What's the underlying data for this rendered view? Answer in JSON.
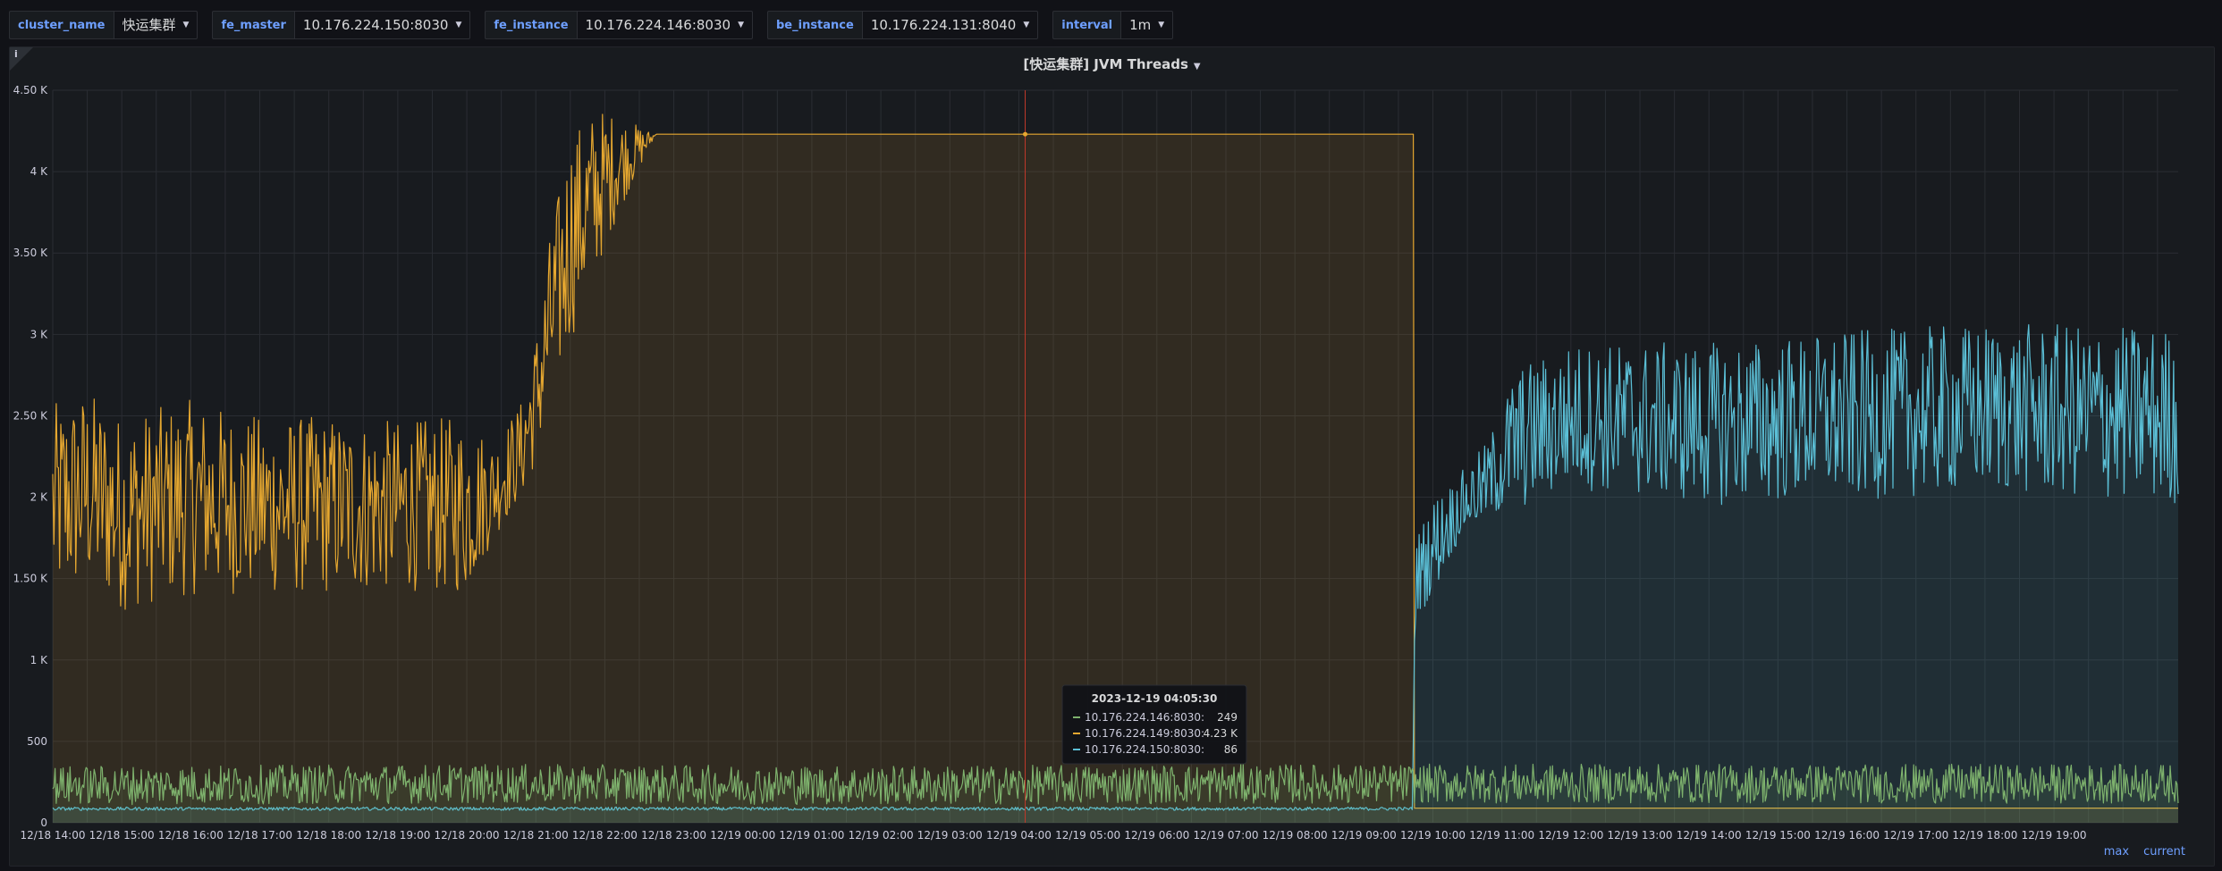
{
  "variables": [
    {
      "label": "cluster_name",
      "value": "快运集群"
    },
    {
      "label": "fe_master",
      "value": "10.176.224.150:8030"
    },
    {
      "label": "fe_instance",
      "value": "10.176.224.146:8030"
    },
    {
      "label": "be_instance",
      "value": "10.176.224.131:8040"
    },
    {
      "label": "interval",
      "value": "1m"
    }
  ],
  "panel": {
    "info_icon": "i",
    "title": "[快运集群] JVM Threads",
    "legend_columns": [
      "max",
      "current"
    ]
  },
  "colors": {
    "yellow": "#e5a730",
    "teal": "#5bbfd6",
    "green": "#7eb26d",
    "grid": "#2a2d33",
    "crosshair": "#c0392b"
  },
  "tooltip": {
    "time": "2023-12-19 04:05:30",
    "rows": [
      {
        "name": "10.176.224.146:8030:",
        "value": "249",
        "color": "#7eb26d"
      },
      {
        "name": "10.176.224.149:8030:",
        "value": "4.23 K",
        "color": "#e5a730"
      },
      {
        "name": "10.176.224.150:8030:",
        "value": "86",
        "color": "#5bbfd6"
      }
    ]
  },
  "chart_data": {
    "type": "line",
    "title": "[快运集群] JVM Threads",
    "x_range": [
      "2023-12-18 14:00",
      "2023-12-19 20:50"
    ],
    "ylim": [
      0,
      4500
    ],
    "y_ticks": [
      0,
      500,
      1000,
      1500,
      2000,
      2500,
      3000,
      3500,
      4000,
      4500
    ],
    "y_tick_labels": [
      "0",
      "500",
      "1 K",
      "1.50 K",
      "2 K",
      "2.50 K",
      "3 K",
      "3.50 K",
      "4 K",
      "4.50 K"
    ],
    "x_tick_labels": [
      "12/18 14:00",
      "12/18 15:00",
      "12/18 16:00",
      "12/18 17:00",
      "12/18 18:00",
      "12/18 19:00",
      "12/18 20:00",
      "12/18 21:00",
      "12/18 22:00",
      "12/18 23:00",
      "12/19 00:00",
      "12/19 01:00",
      "12/19 02:00",
      "12/19 03:00",
      "12/19 04:00",
      "12/19 05:00",
      "12/19 06:00",
      "12/19 07:00",
      "12/19 08:00",
      "12/19 09:00",
      "12/19 10:00",
      "12/19 11:00",
      "12/19 12:00",
      "12/19 13:00",
      "12/19 14:00",
      "12/19 15:00",
      "12/19 16:00",
      "12/19 17:00",
      "12/19 18:00",
      "12/19 19:00"
    ],
    "grid": true,
    "fill": "area",
    "crosshair_time": "2023-12-19 04:05:30",
    "series": [
      {
        "name": "10.176.224.149:8030",
        "color": "#e5a730",
        "hour_offset": [
          0,
          0.5,
          1,
          2,
          3,
          4,
          5,
          6,
          6.4,
          6.8,
          7.0,
          7.2,
          7.5,
          7.9,
          8.2,
          8.6,
          8.75,
          9,
          10,
          12,
          14,
          16,
          18,
          19.7,
          19.7,
          20.0,
          24,
          28,
          30.8
        ],
        "values": [
          1950,
          2050,
          1900,
          2000,
          1950,
          1950,
          1950,
          1950,
          2050,
          2300,
          2600,
          3050,
          3600,
          3900,
          4050,
          4180,
          4230,
          4230,
          4230,
          4230,
          4230,
          4230,
          4230,
          4230,
          90,
          90,
          90,
          90,
          90
        ],
        "noise": [
          620,
          620,
          600,
          600,
          550,
          550,
          520,
          550,
          300,
          300,
          400,
          550,
          650,
          500,
          300,
          80,
          0,
          0,
          0,
          0,
          0,
          0,
          0,
          0,
          0,
          0,
          0,
          0,
          0
        ]
      },
      {
        "name": "10.176.224.150:8030",
        "color": "#5bbfd6",
        "hour_offset": [
          0,
          6,
          12,
          18,
          19.7,
          19.75,
          20.0,
          20.4,
          20.8,
          21.2,
          22,
          24,
          26,
          28,
          30.8
        ],
        "values": [
          86,
          86,
          86,
          86,
          86,
          1500,
          1700,
          1950,
          2100,
          2350,
          2500,
          2450,
          2500,
          2550,
          2500
        ],
        "noise": [
          10,
          10,
          10,
          10,
          10,
          250,
          300,
          200,
          250,
          450,
          450,
          500,
          520,
          520,
          550
        ]
      },
      {
        "name": "10.176.224.146:8030",
        "color": "#7eb26d",
        "hour_offset": [
          0,
          6,
          12,
          18,
          24,
          30.8
        ],
        "values": [
          230,
          240,
          230,
          240,
          240,
          240
        ],
        "noise": [
          120,
          120,
          120,
          120,
          120,
          120
        ]
      }
    ]
  }
}
